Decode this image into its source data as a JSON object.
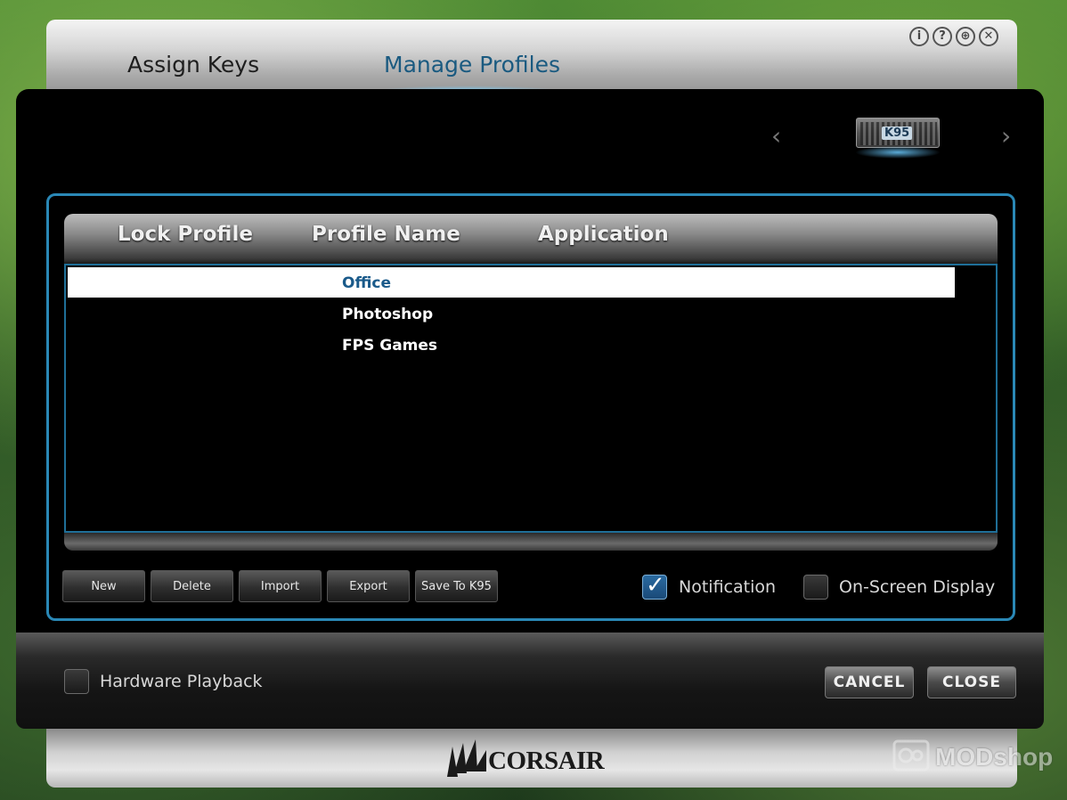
{
  "header": {
    "tabs": [
      {
        "label": "Assign Keys",
        "active": false
      },
      {
        "label": "Manage Profiles",
        "active": true
      }
    ],
    "window_icons": [
      "info-icon",
      "help-icon",
      "globe-icon",
      "close-icon"
    ],
    "window_icon_glyphs": [
      "i",
      "?",
      "⊕",
      "✕"
    ]
  },
  "device": {
    "name": "K95",
    "prev_glyph": "‹",
    "next_glyph": "›"
  },
  "table": {
    "columns": [
      "Lock Profile",
      "Profile Name",
      "Application"
    ],
    "rows": [
      {
        "profile_name": "Office",
        "selected": true
      },
      {
        "profile_name": "Photoshop",
        "selected": false
      },
      {
        "profile_name": "FPS Games",
        "selected": false
      }
    ]
  },
  "actions": {
    "new": "New",
    "delete": "Delete",
    "import": "Import",
    "export": "Export",
    "save_to_device": "Save To K95"
  },
  "options": {
    "notification": {
      "label": "Notification",
      "checked": true
    },
    "on_screen_display": {
      "label": "On-Screen Display",
      "checked": false
    },
    "hardware_playback": {
      "label": "Hardware Playback",
      "checked": false
    }
  },
  "dialog_buttons": {
    "cancel": "CANCEL",
    "close": "CLOSE"
  },
  "brand": {
    "logo": "CORSAIR",
    "watermark": "MODshop"
  },
  "colors": {
    "accent_blue": "#2a88b6",
    "active_tab": "#1a5a80",
    "selected_row_text": "#1a5a8a"
  }
}
